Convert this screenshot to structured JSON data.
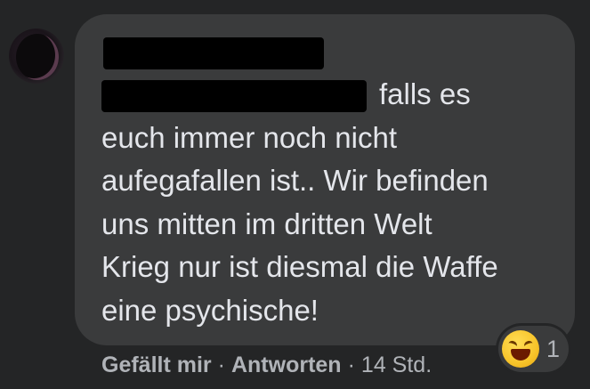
{
  "comment": {
    "author_redacted": "",
    "line1_tail": "falls es",
    "text": "euch immer noch nicht\naufegafallen ist.. Wir befinden\nuns mitten im dritten Welt\nKrieg nur ist diesmal die Waffe\neine psychische!"
  },
  "reactions": {
    "icon": "haha-emoji-icon",
    "count": "1"
  },
  "actions": {
    "like_label": "Gefällt mir",
    "separator": "·",
    "reply_label": "Antworten",
    "time": "14 Std."
  },
  "colors": {
    "background": "#242526",
    "bubble": "#3a3b3c",
    "text": "#e4e6eb",
    "secondary_text": "#b0b3b8"
  }
}
